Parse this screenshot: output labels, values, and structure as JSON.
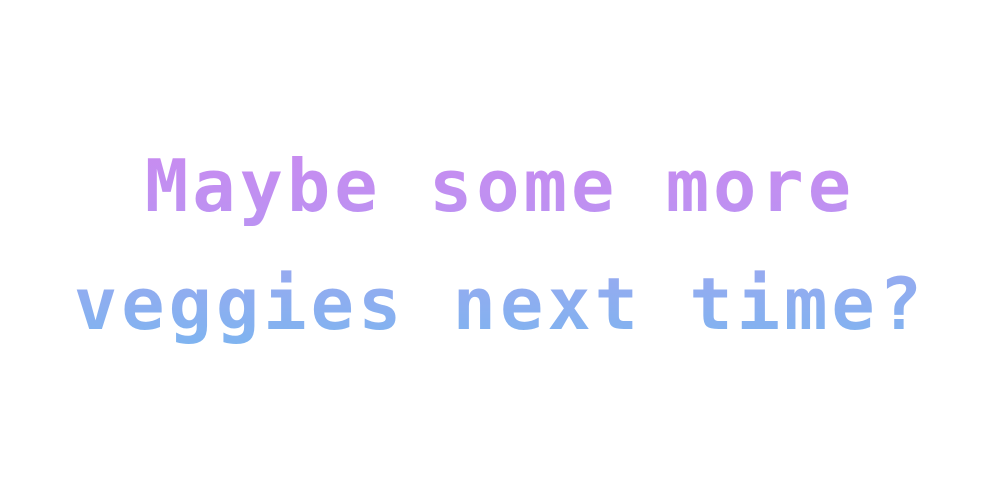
{
  "message": {
    "line1": "Maybe some more",
    "line2": "veggies next time?"
  },
  "colors": {
    "background": "#ffffff",
    "line1_top": "#cc8af0",
    "line1_bottom": "#b894f2",
    "line2_top": "#9fa7f0",
    "line2_bottom": "#79b6f0"
  }
}
